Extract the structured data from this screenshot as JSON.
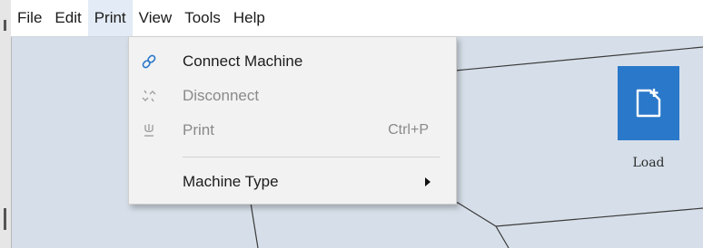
{
  "menubar": {
    "items": [
      "File",
      "Edit",
      "Print",
      "View",
      "Tools",
      "Help"
    ],
    "active": "Print"
  },
  "print_menu": {
    "items": [
      {
        "label": "Connect Machine",
        "icon": "link-icon",
        "enabled": true
      },
      {
        "label": "Disconnect",
        "icon": "unlink-icon",
        "enabled": false
      },
      {
        "label": "Print",
        "icon": "plug-icon",
        "enabled": false,
        "shortcut": "Ctrl+P"
      },
      {
        "label": "Machine Type",
        "enabled": true,
        "submenu": true
      }
    ]
  },
  "toolbar": {
    "load_label": "Load",
    "load_icon": "add-file-icon"
  },
  "colors": {
    "canvas": "#d6dfe9",
    "accent": "#2a78c9",
    "menu_bg": "#f2f2f2",
    "disabled_text": "#8a8a8a"
  }
}
